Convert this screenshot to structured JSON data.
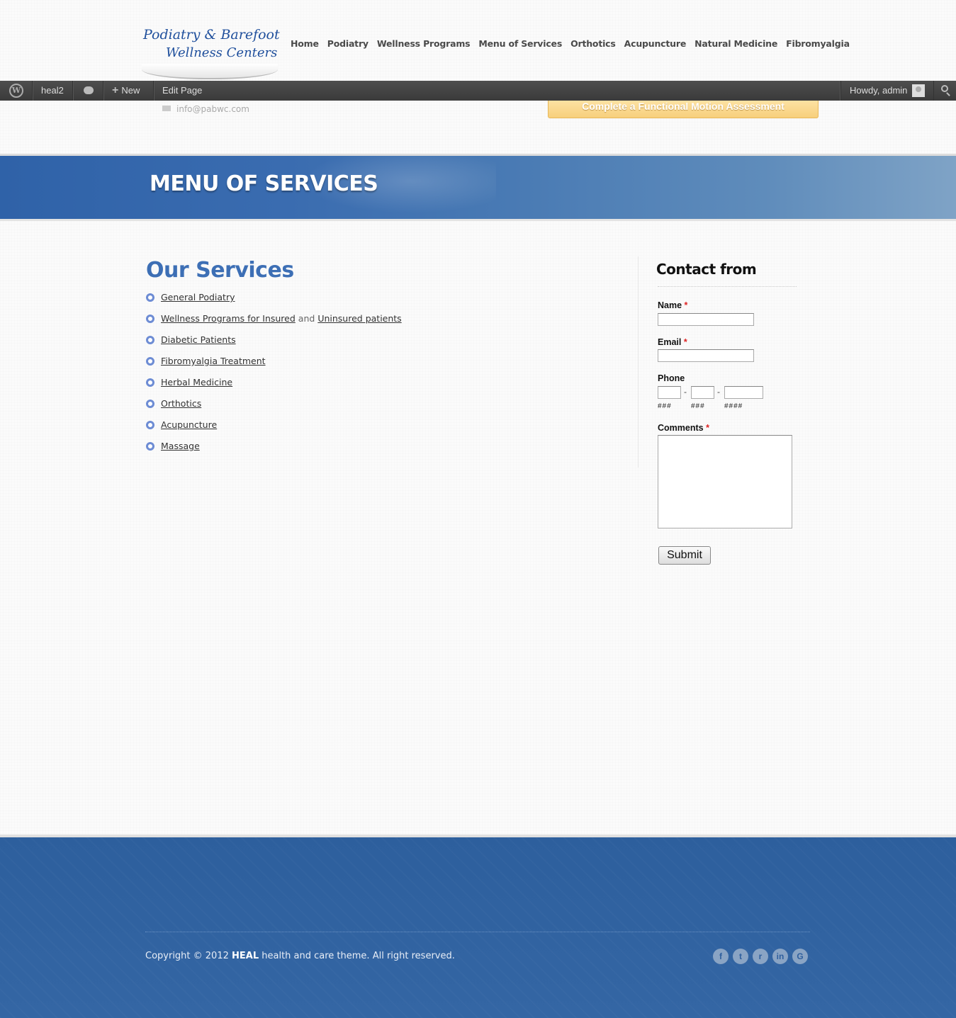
{
  "logo": {
    "line1": "Podiatry & Barefoot",
    "line2": "Wellness Centers"
  },
  "nav": [
    "Home",
    "Podiatry",
    "Wellness Programs",
    "Menu of Services",
    "Orthotics",
    "Acupuncture",
    "Natural Medicine",
    "Fibromyalgia"
  ],
  "adminbar": {
    "site": "heal2",
    "new_label": "New",
    "edit_label": "Edit Page",
    "howdy": "Howdy, admin"
  },
  "header": {
    "email": "info@pabwc.com",
    "cta": "Complete a Functional Motion Assessment"
  },
  "banner": {
    "title": "MENU OF SERVICES"
  },
  "content": {
    "title": "Our Services",
    "services": [
      "General Podiatry",
      "Wellness Programs for Insured",
      "Diabetic Patients",
      "Fibromyalgia Treatment",
      "Herbal Medicine",
      "Orthotics",
      "Acupuncture",
      "Massage"
    ],
    "and": "and",
    "uninsured": "Uninsured patients"
  },
  "form": {
    "title": "Contact from",
    "name_label": "Name",
    "email_label": "Email",
    "phone_label": "Phone",
    "comments_label": "Comments",
    "required": "*",
    "phone_dash": "-",
    "hint1": "###",
    "hint2": "###",
    "hint3": "####",
    "submit": "Submit"
  },
  "footer": {
    "copyright_pre": "Copyright © 2012 ",
    "brand": "HEAL",
    "copyright_post": " health and care theme. All right reserved.",
    "social_icons": [
      "facebook-icon",
      "twitter-icon",
      "rss-icon",
      "linkedin-icon",
      "google-icon"
    ],
    "social_glyphs": [
      "f",
      "t",
      "r",
      "in",
      "G"
    ]
  },
  "colors": {
    "accent": "#3d6fb5",
    "banner": "#2f62a8",
    "footer": "#2f62a0",
    "cta": "#f7cf7c",
    "adminbar": "#464646"
  }
}
